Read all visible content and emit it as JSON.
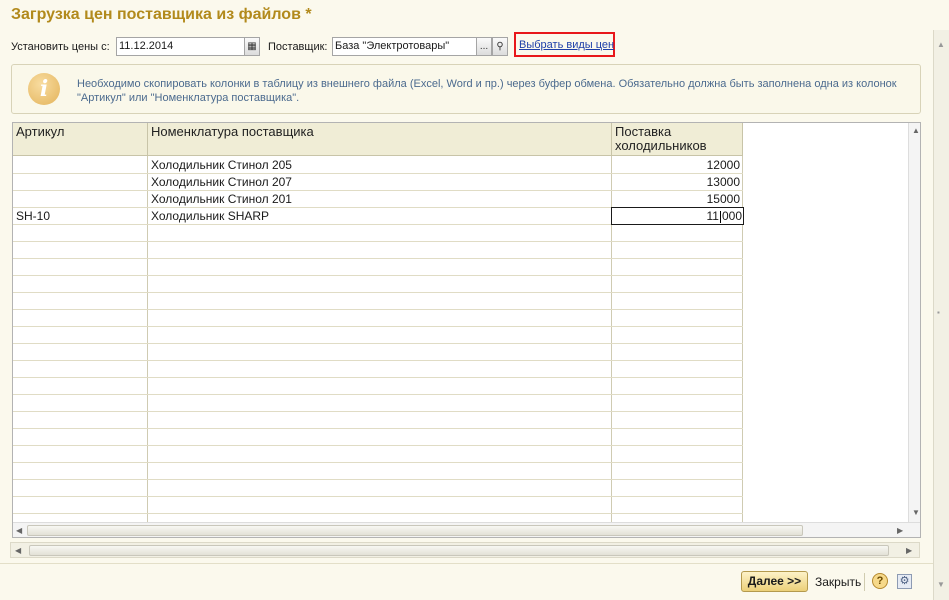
{
  "window": {
    "title": "Загрузка цен поставщика из файлов *"
  },
  "toolbar": {
    "date_label": "Установить цены с:",
    "date_value": "11.12.2014",
    "supplier_label": "Поставщик:",
    "supplier_value": "База \"Электротовары\"",
    "supplier_select_btn": "...",
    "select_price_types_link": "Выбрать виды цен"
  },
  "info": {
    "icon": "info-icon",
    "text": "Необходимо скопировать колонки в таблицу из внешнего файла (Excel, Word и пр.) через буфер обмена. Обязательно должна быть заполнена одна из колонок \"Артикул\" или \"Номенклатура поставщика\"."
  },
  "table": {
    "columns": [
      "Артикул",
      "Номенклатура поставщика",
      "Поставка холодильников"
    ],
    "rows": [
      {
        "article": "",
        "name": "Холодильник Стинол 205",
        "price": "12000"
      },
      {
        "article": "",
        "name": "Холодильник Стинол 207",
        "price": "13000"
      },
      {
        "article": "",
        "name": "Холодильник Стинол 201",
        "price": "15000"
      },
      {
        "article": "SH-10",
        "name": "Холодильник SHARP",
        "price_before_cursor": "11",
        "price_after_cursor": "000"
      }
    ]
  },
  "footer": {
    "next_button": "Далее >>",
    "close_button": "Закрыть",
    "help_button": "?",
    "help_icon": "help-icon",
    "settings_icon": "gear-icon"
  },
  "colors": {
    "title": "#b28a1c",
    "link": "#1d3ea8",
    "highlight_border": "#e8171b",
    "info_text": "#4b6a8e",
    "background": "#fbf9ed"
  }
}
